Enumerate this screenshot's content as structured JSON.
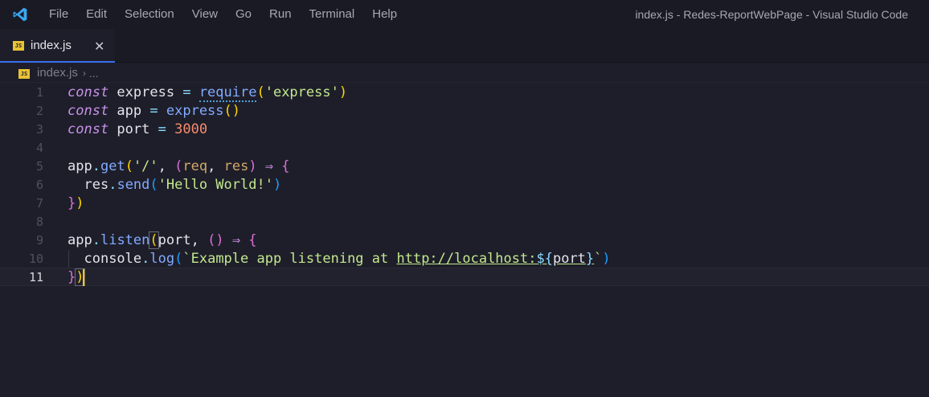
{
  "menu": [
    "File",
    "Edit",
    "Selection",
    "View",
    "Go",
    "Run",
    "Terminal",
    "Help"
  ],
  "window_title": "index.js - Redes-ReportWebPage - Visual Studio Code",
  "tab": {
    "badge": "JS",
    "label": "index.js",
    "close": "✕"
  },
  "breadcrumb": {
    "badge": "JS",
    "file": "index.js",
    "sep": "›",
    "more": "..."
  },
  "line_numbers": [
    "1",
    "2",
    "3",
    "4",
    "5",
    "6",
    "7",
    "8",
    "9",
    "10",
    "11"
  ],
  "code": {
    "l1": {
      "kw": "const",
      "name": " express ",
      "eq": "=",
      "fn": "require",
      "p1": "(",
      "str": "'express'",
      "p2": ")"
    },
    "l2": {
      "kw": "const",
      "name": " app ",
      "eq": "=",
      "fn": "express",
      "p1": "(",
      "p2": ")"
    },
    "l3": {
      "kw": "const",
      "name": " port ",
      "eq": "=",
      "num": "3000"
    },
    "l5": {
      "obj": "app",
      "dot": ".",
      "fn": "get",
      "p1": "(",
      "str": "'/'",
      "comma": ", ",
      "p2": "(",
      "a1": "req",
      "c2": ", ",
      "a2": "res",
      "p3": ")",
      "arrow": " ⇒ ",
      "brace": "{"
    },
    "l6": {
      "indent": "  ",
      "obj": "res",
      "dot": ".",
      "fn": "send",
      "p1": "(",
      "str": "'Hello World!'",
      "p2": ")"
    },
    "l7": {
      "brace": "}",
      "paren": ")"
    },
    "l9": {
      "obj": "app",
      "dot": ".",
      "fn": "listen",
      "p1": "(",
      "arg": "port",
      "comma": ", ",
      "p2": "(",
      "p3": ")",
      "arrow": " ⇒ ",
      "brace": "{"
    },
    "l10": {
      "indent": "  ",
      "obj": "console",
      "dot": ".",
      "fn": "log",
      "p1": "(",
      "tick": "`",
      "text": "Example app listening at ",
      "url": "http://localhost:",
      "d1": "${",
      "var": "port",
      "d2": "}",
      "tick2": "`",
      "p2": ")"
    },
    "l11": {
      "brace": "}",
      "paren": ")"
    }
  },
  "colors": {
    "background": "#1e1e2a",
    "keyword": "#c792ea",
    "function": "#82aaff",
    "string": "#c3e88d",
    "number": "#f78c6c",
    "cursor": "#ffcc00",
    "accent": "#3a6df0"
  },
  "icons": {
    "logo": "vscode-logo-icon",
    "file": "javascript-file-icon",
    "close": "close-icon"
  }
}
